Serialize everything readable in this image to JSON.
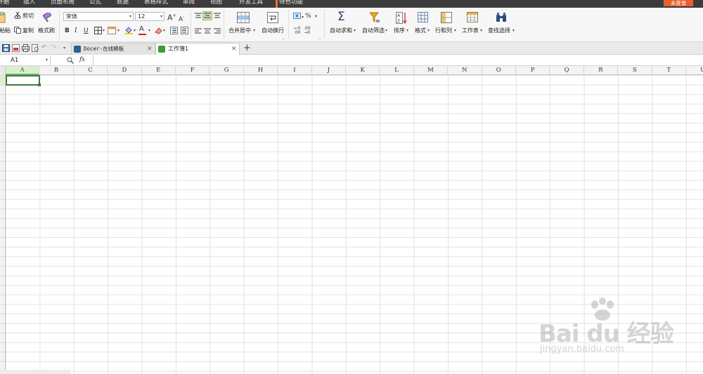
{
  "menu": {
    "items": [
      "开始",
      "插入",
      "页面布局",
      "公式",
      "数据",
      "表格样式",
      "审阅",
      "视图",
      "开发工具",
      "特色功能"
    ],
    "login": "未登录"
  },
  "ribbon": {
    "paste": "粘贴",
    "cut": "剪切",
    "copy": "复制",
    "format_painter": "格式刷",
    "font_name": "宋体",
    "font_size": "12",
    "bold": "B",
    "italic": "I",
    "underline": "U",
    "grow_font": "A",
    "shrink_font": "A",
    "font_color_glyph": "A",
    "merge_center": "合并居中",
    "wrap_text": "自动换行",
    "percent": "%",
    "sum_glyph": "Σ",
    "auto_sum": "自动求和",
    "auto_filter": "自动筛选",
    "sort": "排序",
    "format": "格式",
    "row_col": "行和列",
    "worksheet": "工作表",
    "find_select": "查找选择"
  },
  "tabs": {
    "docer": "Docer-在线模板",
    "workbook": "工作簿1",
    "new_tab": "+"
  },
  "formula_bar": {
    "name_box": "A1",
    "fx": "fx"
  },
  "grid": {
    "columns": [
      "A",
      "B",
      "C",
      "D",
      "E",
      "F",
      "G",
      "H",
      "I",
      "J",
      "K",
      "L",
      "M",
      "N",
      "O",
      "P",
      "Q",
      "R",
      "S",
      "T",
      "U"
    ],
    "selected_column": "A"
  },
  "watermark": {
    "logo": "Bai du 经验",
    "url": "jingyan.baidu.com"
  }
}
